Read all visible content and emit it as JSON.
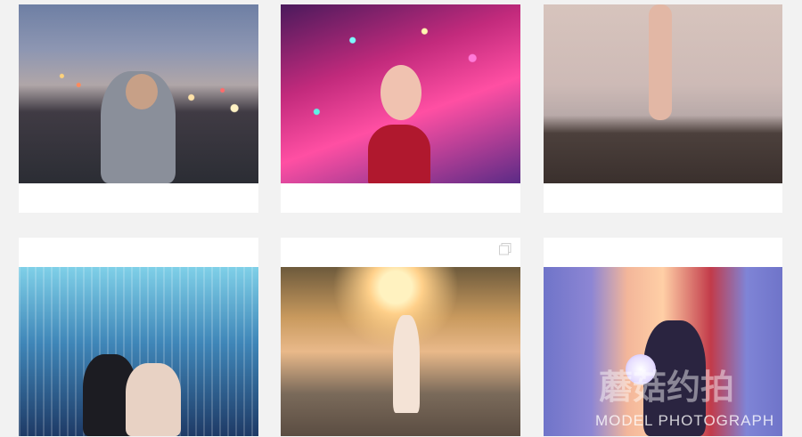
{
  "grid": {
    "posts": [
      {
        "subject": "girl in sweatshirt on city street at dusk"
      },
      {
        "subject": "smiling girl under pink and teal fairy lights"
      },
      {
        "subject": "ballet pointe shoe over water and rocks"
      },
      {
        "subject": "couple under blue light curtain"
      },
      {
        "subject": "dancer leaping on rocks at sunset"
      },
      {
        "subject": "girl in witch hat holding glowing orb"
      }
    ]
  },
  "watermark": {
    "logo": "蘑菇约拍",
    "text": "MODEL PHOTOGRAPH"
  },
  "icons": {
    "multi_post": "carousel-icon"
  },
  "colors": {
    "background": "#f2f2f2",
    "card": "#ffffff"
  }
}
